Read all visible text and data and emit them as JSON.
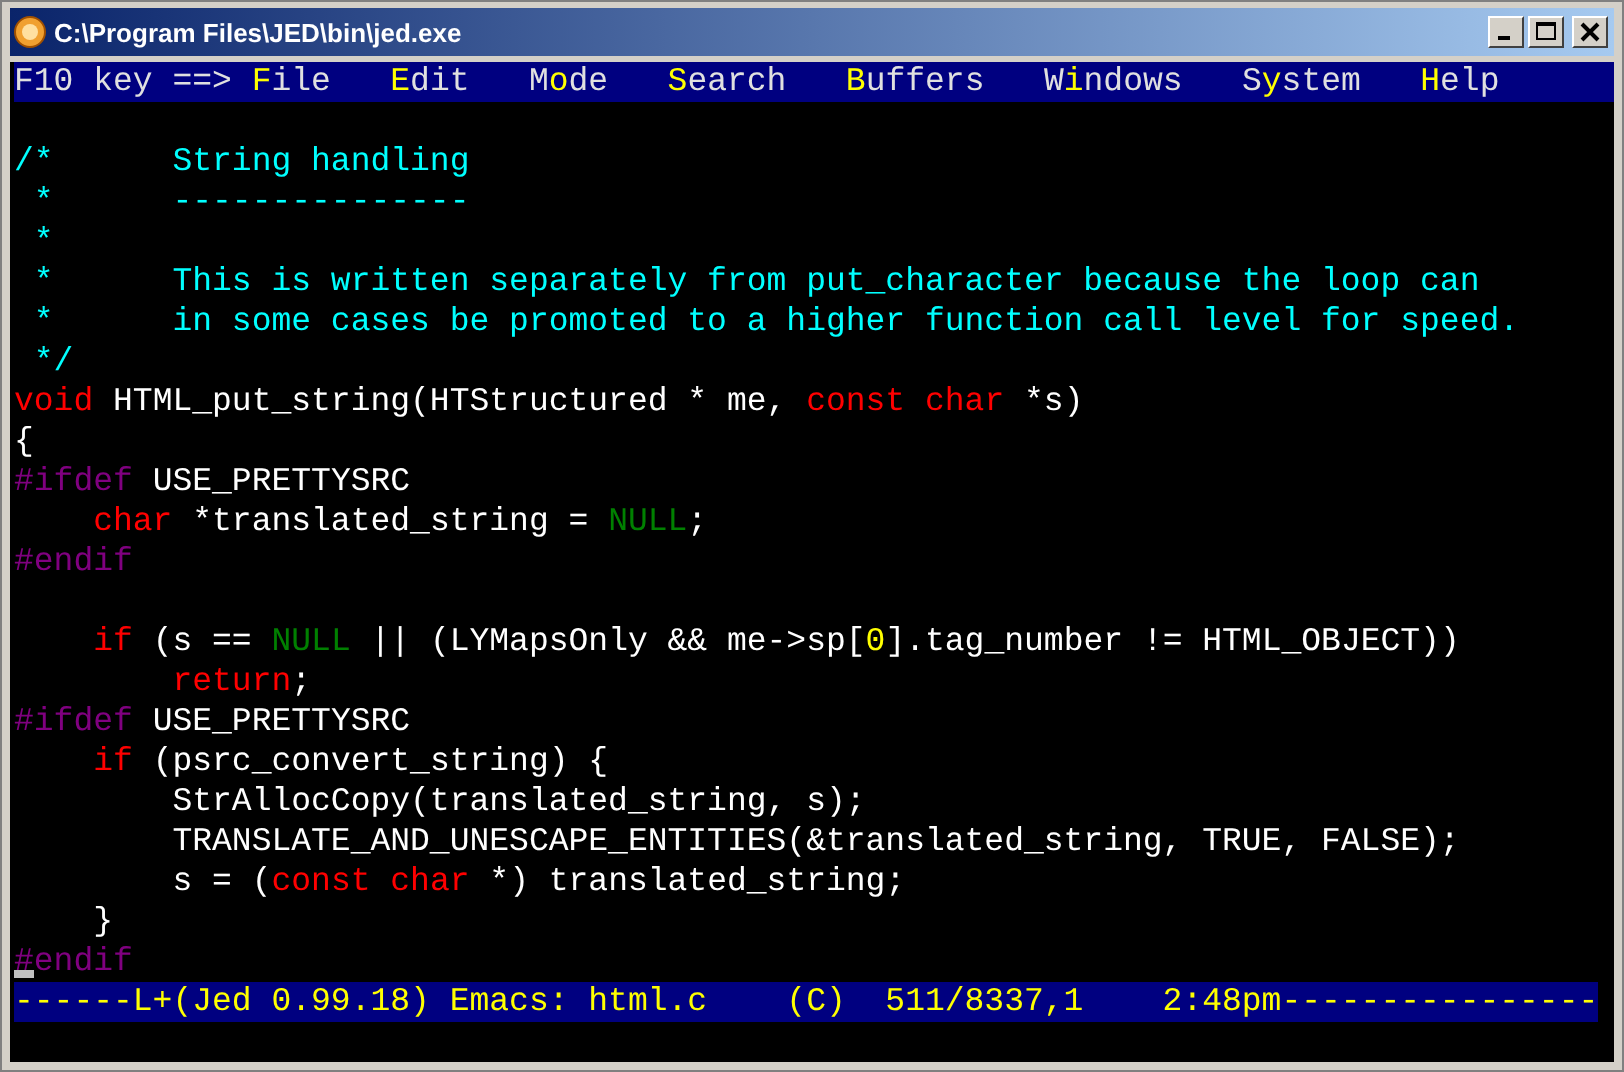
{
  "window": {
    "title": "C:\\Program Files\\JED\\bin\\jed.exe"
  },
  "menu_bar": {
    "prompt": "F10 key ==>",
    "items": [
      {
        "key": "F",
        "after": "ile"
      },
      {
        "key": "E",
        "after": "dit"
      },
      {
        "before": "M",
        "key": "o",
        "after": "de"
      },
      {
        "key": "S",
        "after": "earch"
      },
      {
        "key": "B",
        "after": "uffers"
      },
      {
        "before": "W",
        "key": "i",
        "after": "ndows"
      },
      {
        "before": "S",
        "key": "y",
        "after": "stem"
      },
      {
        "key": "H",
        "after": "elp"
      }
    ]
  },
  "lines": [
    {
      "kind": "blank"
    },
    {
      "kind": "code",
      "segments": [
        {
          "kind": "comment",
          "text": "/*      String handling"
        }
      ]
    },
    {
      "kind": "code",
      "segments": [
        {
          "kind": "comment",
          "text": " *      ---------------"
        }
      ]
    },
    {
      "kind": "code",
      "segments": [
        {
          "kind": "comment",
          "text": " *"
        }
      ]
    },
    {
      "kind": "code",
      "segments": [
        {
          "kind": "comment",
          "text": " *      This is written separately from put_character because the loop can"
        }
      ]
    },
    {
      "kind": "code",
      "segments": [
        {
          "kind": "comment",
          "text": " *      in some cases be promoted to a higher function call level for speed."
        }
      ]
    },
    {
      "kind": "code",
      "segments": [
        {
          "kind": "comment",
          "text": " */"
        }
      ]
    },
    {
      "kind": "code",
      "segments": [
        {
          "kind": "keyword",
          "text": "void"
        },
        {
          "kind": "plain",
          "text": " HTML_put_string(HTStructured * me, "
        },
        {
          "kind": "keyword",
          "text": "const char"
        },
        {
          "kind": "plain",
          "text": " *s)"
        }
      ]
    },
    {
      "kind": "code",
      "segments": [
        {
          "kind": "plain",
          "text": "{"
        }
      ]
    },
    {
      "kind": "code",
      "segments": [
        {
          "kind": "preprocessor",
          "text": "#ifdef"
        },
        {
          "kind": "plain",
          "text": " USE_PRETTYSRC"
        }
      ]
    },
    {
      "kind": "code",
      "segments": [
        {
          "kind": "keyword",
          "text": "    char"
        },
        {
          "kind": "plain",
          "text": " *translated_string = "
        },
        {
          "kind": "constant",
          "text": "NULL"
        },
        {
          "kind": "plain",
          "text": ";"
        }
      ]
    },
    {
      "kind": "code",
      "segments": [
        {
          "kind": "preprocessor",
          "text": "#endif"
        }
      ]
    },
    {
      "kind": "blank"
    },
    {
      "kind": "code",
      "segments": [
        {
          "kind": "keyword",
          "text": "    if"
        },
        {
          "kind": "plain",
          "text": " (s == "
        },
        {
          "kind": "constant",
          "text": "NULL"
        },
        {
          "kind": "plain",
          "text": " || (LYMapsOnly && me->sp["
        },
        {
          "kind": "number",
          "text": "0"
        },
        {
          "kind": "plain",
          "text": "].tag_number != HTML_OBJECT))"
        }
      ]
    },
    {
      "kind": "code",
      "segments": [
        {
          "kind": "keyword",
          "text": "        return"
        },
        {
          "kind": "plain",
          "text": ";"
        }
      ]
    },
    {
      "kind": "code",
      "segments": [
        {
          "kind": "preprocessor",
          "text": "#ifdef"
        },
        {
          "kind": "plain",
          "text": " USE_PRETTYSRC"
        }
      ]
    },
    {
      "kind": "code",
      "segments": [
        {
          "kind": "keyword",
          "text": "    if"
        },
        {
          "kind": "plain",
          "text": " (psrc_convert_string) {"
        }
      ]
    },
    {
      "kind": "code",
      "segments": [
        {
          "kind": "plain",
          "text": "        StrAllocCopy(translated_string, s);"
        }
      ]
    },
    {
      "kind": "code",
      "segments": [
        {
          "kind": "plain",
          "text": "        TRANSLATE_AND_UNESCAPE_ENTITIES(&translated_string, TRUE, FALSE);"
        }
      ]
    },
    {
      "kind": "code",
      "segments": [
        {
          "kind": "plain",
          "text": "        s = ("
        },
        {
          "kind": "keyword",
          "text": "const char"
        },
        {
          "kind": "plain",
          "text": " *) translated_string;"
        }
      ]
    },
    {
      "kind": "code",
      "segments": [
        {
          "kind": "plain",
          "text": "    }"
        }
      ]
    },
    {
      "kind": "code",
      "cursor": true,
      "segments": [
        {
          "kind": "preprocessor",
          "text": "#endif"
        }
      ]
    }
  ],
  "status_line": "------L+(Jed 0.99.18) Emacs: html.c    (C)  511/8337,1    2:48pm----------------"
}
